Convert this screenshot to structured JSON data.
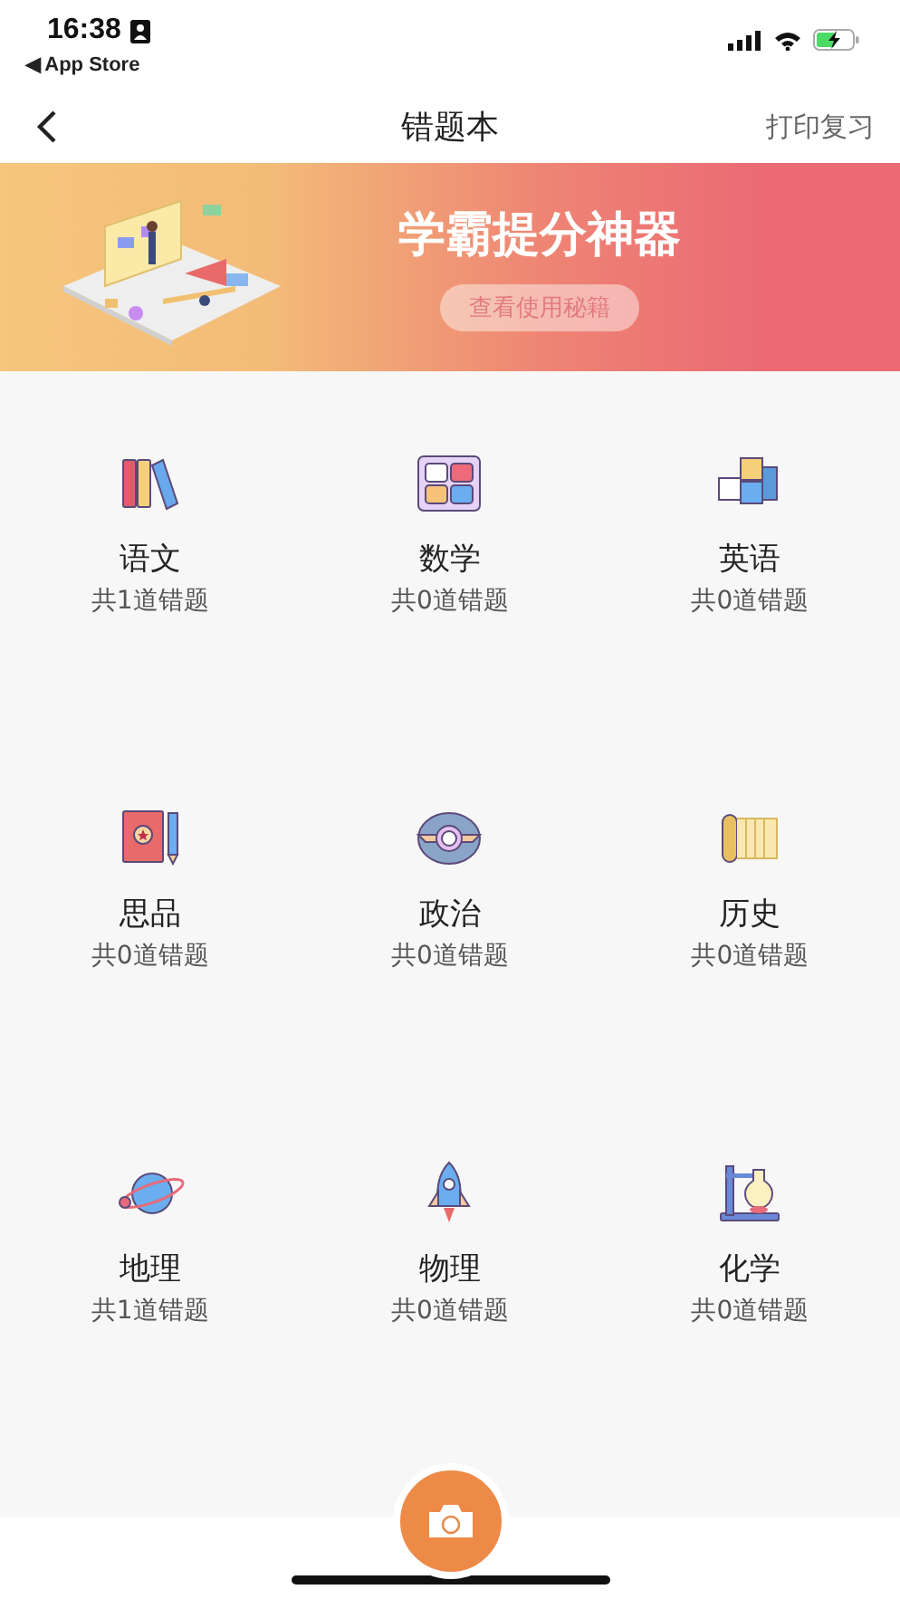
{
  "status_bar": {
    "time": "16:38",
    "back_link": "◀ App Store"
  },
  "nav": {
    "title": "错题本",
    "action": "打印复习"
  },
  "banner": {
    "title": "学霸提分神器",
    "button": "查看使用秘籍"
  },
  "subjects": [
    {
      "kind": "books",
      "name": "语文",
      "count": "共1道错题"
    },
    {
      "kind": "calculator",
      "name": "数学",
      "count": "共0道错题"
    },
    {
      "kind": "blocks",
      "name": "英语",
      "count": "共0道错题"
    },
    {
      "kind": "notebook",
      "name": "思品",
      "count": "共0道错题"
    },
    {
      "kind": "emblem",
      "name": "政治",
      "count": "共0道错题"
    },
    {
      "kind": "scroll",
      "name": "历史",
      "count": "共0道错题"
    },
    {
      "kind": "planet",
      "name": "地理",
      "count": "共1道错题"
    },
    {
      "kind": "rocket",
      "name": "物理",
      "count": "共0道错题"
    },
    {
      "kind": "flask",
      "name": "化学",
      "count": "共0道错题"
    }
  ]
}
